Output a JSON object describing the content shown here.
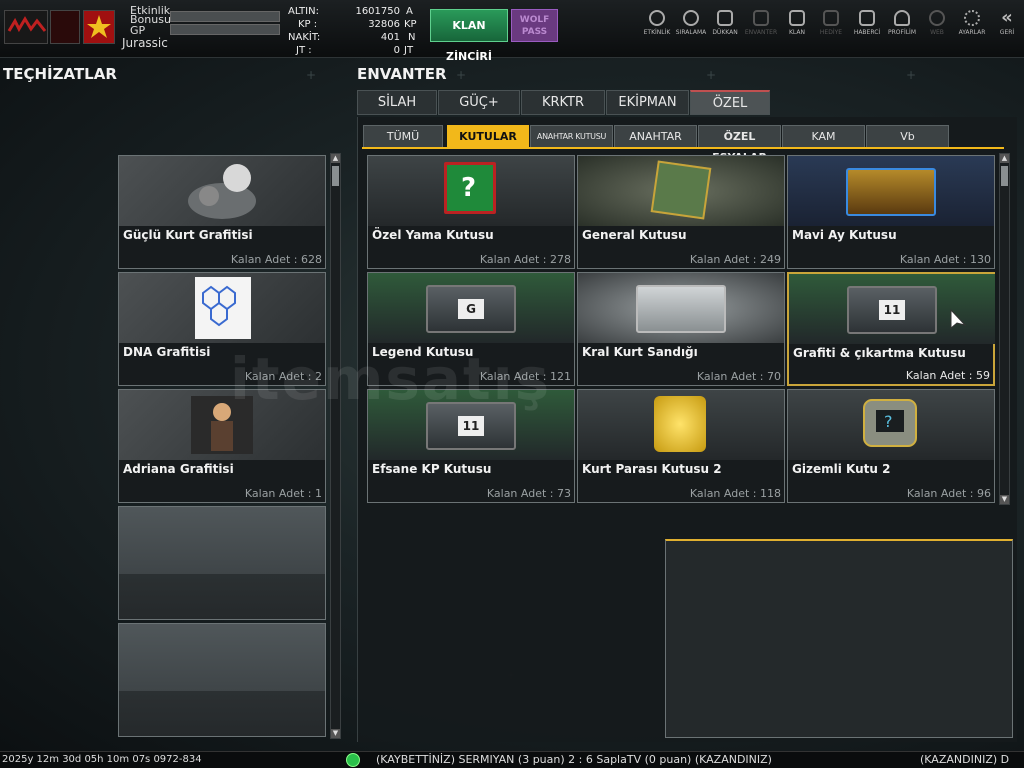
{
  "topbar": {
    "player_name": "Jurassic",
    "labels": {
      "etkinlik": "Etkinlik",
      "bonusu": "Bonusu",
      "gp": "GP"
    },
    "currencies": [
      {
        "label": "ALTIN:",
        "value": "1601750",
        "unit": "A"
      },
      {
        "label": "KP :",
        "value": "32806",
        "unit": "KP"
      },
      {
        "label": "NAKİT:",
        "value": "401",
        "unit": "N"
      },
      {
        "label": "JT :",
        "value": "0",
        "unit": "JT"
      }
    ],
    "klan_button": "KLAN ZİNCİRİ",
    "wolf_button_1": "WOLF",
    "wolf_button_2": "PASS",
    "nav": [
      {
        "label": "ETKİNLİK",
        "icon": "clock-icon",
        "enabled": true
      },
      {
        "label": "SIRALAMA",
        "icon": "medal-icon",
        "enabled": true
      },
      {
        "label": "DÜKKAN",
        "icon": "cart-icon",
        "enabled": true
      },
      {
        "label": "ENVANTER",
        "icon": "inventory-icon",
        "enabled": false
      },
      {
        "label": "KLAN",
        "icon": "shield-icon",
        "enabled": true
      },
      {
        "label": "HEDİYE",
        "icon": "gift-icon",
        "enabled": false
      },
      {
        "label": "HABERCİ",
        "icon": "megaphone-icon",
        "enabled": true
      },
      {
        "label": "PROFİLİM",
        "icon": "profile-icon",
        "enabled": true
      },
      {
        "label": "WEB",
        "icon": "globe-icon",
        "enabled": false
      },
      {
        "label": "AYARLAR",
        "icon": "gear-icon",
        "enabled": true
      },
      {
        "label": "GERİ",
        "icon": "back-icon",
        "enabled": true
      }
    ]
  },
  "left": {
    "title": "TEÇHİZATLAR",
    "cards": [
      {
        "name": "Güçlü Kurt Grafitisi",
        "count": "Kalan Adet : 628"
      },
      {
        "name": "DNA Grafitisi",
        "count": "Kalan Adet : 2"
      },
      {
        "name": "Adriana Grafitisi",
        "count": "Kalan Adet : 1"
      }
    ]
  },
  "right": {
    "title": "ENVANTER",
    "tabs": [
      "SİLAH",
      "GÜÇ+",
      "KRKTR",
      "EKİPMAN",
      "ÖZEL"
    ],
    "subtabs": [
      "TÜMÜ",
      "KUTULAR",
      "ANAHTAR KUTUSU",
      "ANAHTAR",
      "ÖZEL EŞYALAR",
      "KAM",
      "Vb"
    ],
    "items": [
      {
        "name": "Özel Yama Kutusu",
        "count": "Kalan Adet : 278"
      },
      {
        "name": "General Kutusu",
        "count": "Kalan Adet : 249"
      },
      {
        "name": "Mavi Ay Kutusu",
        "count": "Kalan Adet : 130"
      },
      {
        "name": "Legend Kutusu",
        "count": "Kalan Adet : 121"
      },
      {
        "name": "Kral Kurt Sandığı",
        "count": "Kalan Adet : 70"
      },
      {
        "name": "Grafiti & çıkartma Kutusu",
        "count": "Kalan Adet : 59"
      },
      {
        "name": "Efsane KP Kutusu",
        "count": "Kalan Adet : 73"
      },
      {
        "name": "Kurt Parası Kutusu 2",
        "count": "Kalan Adet : 118"
      },
      {
        "name": "Gizemli Kutu 2",
        "count": "Kalan Adet : 96"
      }
    ],
    "box_badges": {
      "legend": "G",
      "grafiti": "11",
      "efsane": "11",
      "ozel": "?"
    }
  },
  "watermark": "itemsatış",
  "footer": {
    "left": "2025y 12m 30d 05h 10m 07s 0972-834",
    "ticker": "(KAYBETTİNİZ) SERMIYAN (3 puan) 2 : 6 SaplaTV (0 puan) (KAZANDINIZ)",
    "right": "(KAZANDINIZ) D"
  }
}
